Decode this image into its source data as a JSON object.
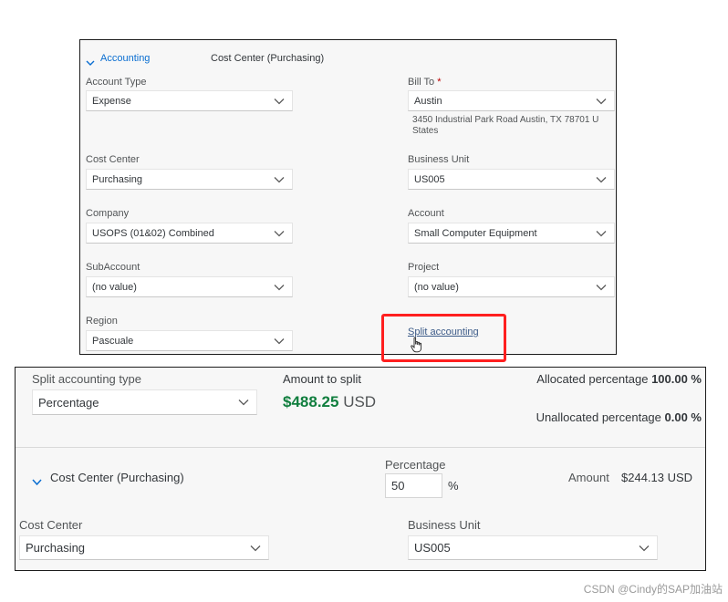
{
  "top_panel": {
    "section_toggle": "Accounting",
    "section_subtitle": "Cost Center (Purchasing)",
    "account_type": {
      "label": "Account Type",
      "value": "Expense"
    },
    "bill_to": {
      "label": "Bill To",
      "required": "*",
      "value": "Austin",
      "address_line1": "3450 Industrial Park Road Austin, TX 78701 U",
      "address_line2": "States"
    },
    "cost_center": {
      "label": "Cost Center",
      "value": "Purchasing"
    },
    "business_unit": {
      "label": "Business Unit",
      "value": "US005"
    },
    "company": {
      "label": "Company",
      "value": "USOPS (01&02) Combined"
    },
    "account": {
      "label": "Account",
      "value": "Small Computer Equipment"
    },
    "subaccount": {
      "label": "SubAccount",
      "value": "(no value)"
    },
    "project": {
      "label": "Project",
      "value": "(no value)"
    },
    "region": {
      "label": "Region",
      "value": "Pascuale"
    },
    "split_link": "Split accounting"
  },
  "bottom_panel": {
    "split_type": {
      "label": "Split accounting type",
      "value": "Percentage"
    },
    "amount_to_split": {
      "label": "Amount to split",
      "amount": "$488.25",
      "currency": "USD"
    },
    "allocated": {
      "label": "Allocated percentage",
      "value": "100.00 %"
    },
    "unallocated": {
      "label": "Unallocated percentage",
      "value": "0.00 %"
    },
    "line": {
      "title": "Cost Center (Purchasing)",
      "percentage_label": "Percentage",
      "percentage_value": "50",
      "percent_sign": "%",
      "amount_label": "Amount",
      "amount_value": "$244.13 USD"
    },
    "cost_center": {
      "label": "Cost Center",
      "value": "Purchasing"
    },
    "business_unit": {
      "label": "Business Unit",
      "value": "US005"
    }
  },
  "watermark": "CSDN @Cindy的SAP加油站",
  "colors": {
    "link": "#0a6ed1",
    "amount_green": "#107e3e",
    "highlight_red": "#ff1f1f",
    "required_red": "#bb0000"
  }
}
